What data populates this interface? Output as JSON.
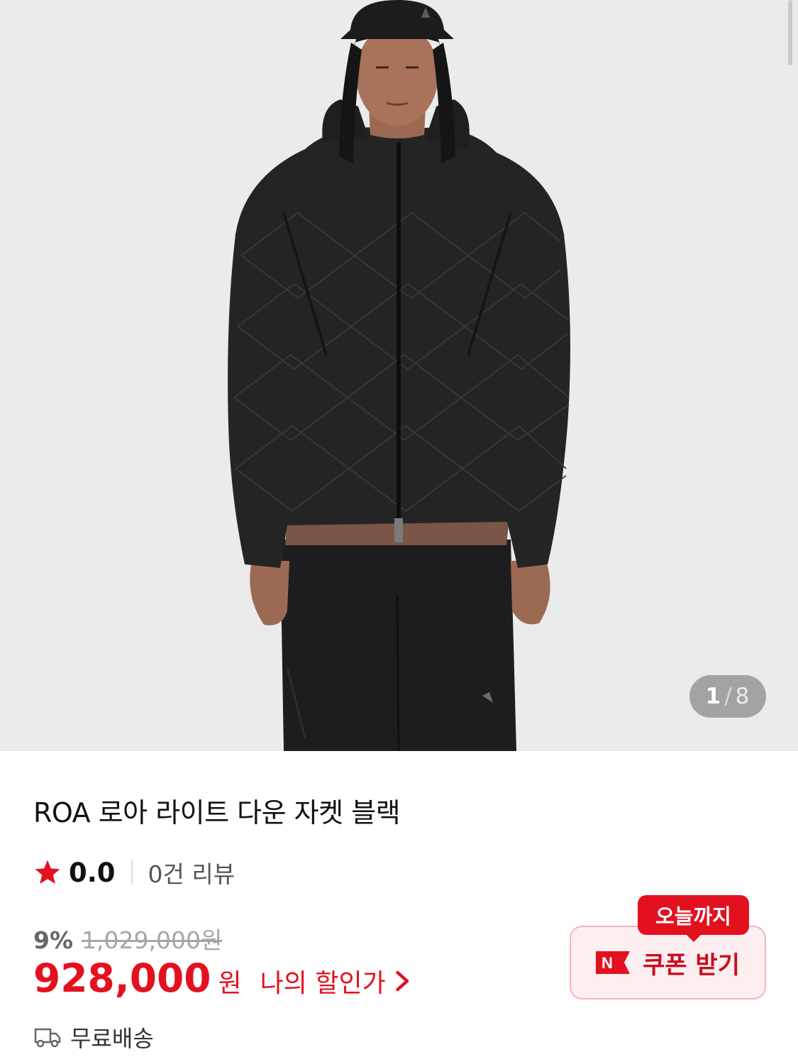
{
  "product_image": {
    "current_index": "1",
    "separator": "/",
    "total": "8"
  },
  "product": {
    "title": "ROA 로아 라이트 다운 자켓 블랙",
    "rating": "0.0",
    "review_count": "0건 리뷰",
    "discount_rate": "9%",
    "original_price": "1,029,000원",
    "sale_price": "928,000",
    "currency": "원",
    "my_price_link": "나의 할인가",
    "shipping": "무료배송"
  },
  "coupon": {
    "badge": "오늘까지",
    "label": "쿠폰 받기",
    "n_icon_text": "N"
  },
  "colors": {
    "accent_red": "#e3111f",
    "coupon_bg": "#fdeff0",
    "coupon_border": "#f3b6bb",
    "image_bg": "#ebebeb"
  },
  "icons": [
    "star-icon",
    "chevron-right-icon",
    "truck-icon",
    "n-badge-icon"
  ]
}
